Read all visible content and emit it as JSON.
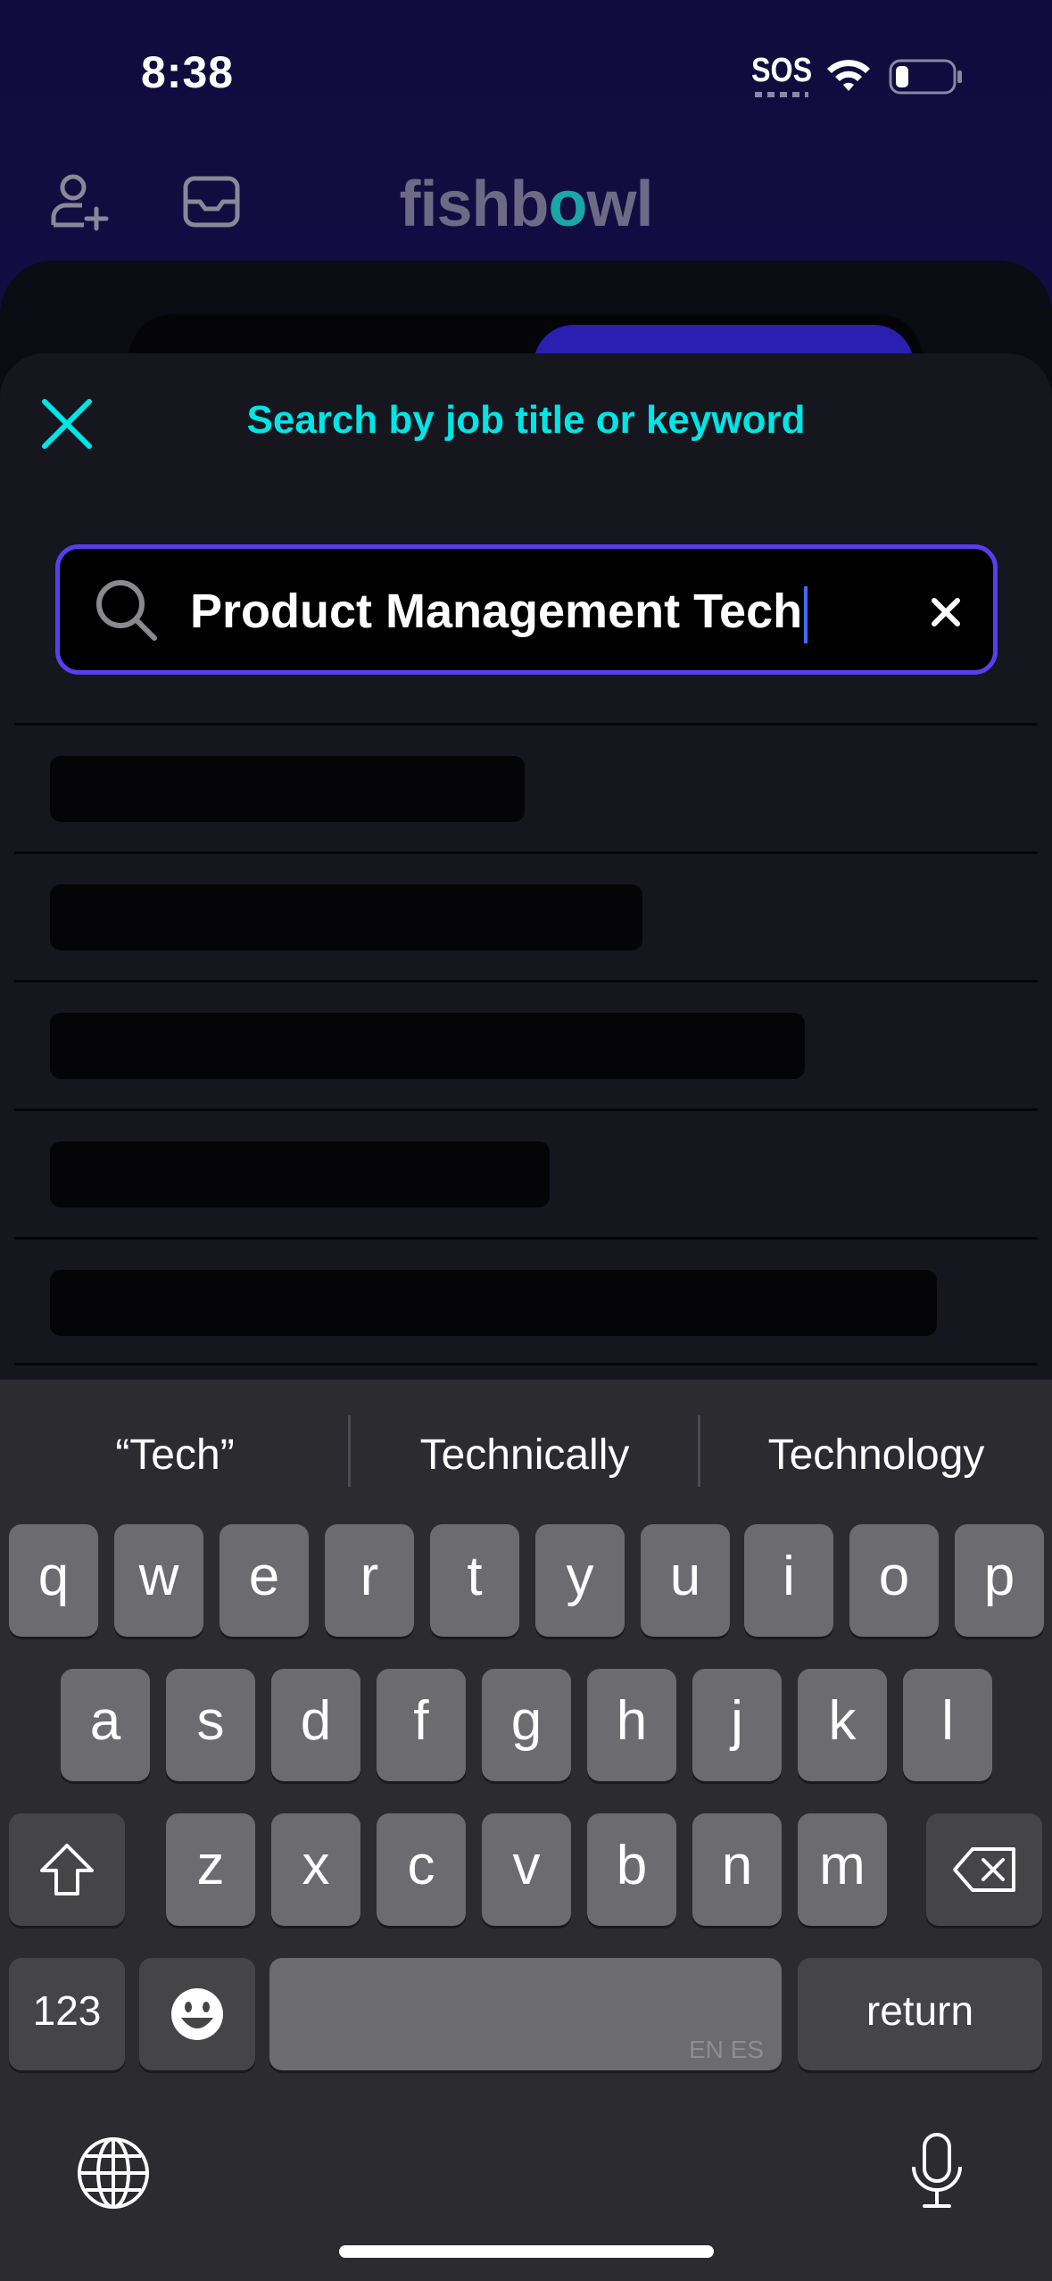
{
  "status_bar": {
    "time": "8:38",
    "sos": "SOS",
    "icons": [
      "wifi-icon",
      "battery-icon"
    ]
  },
  "header": {
    "logo_before": "fishb",
    "logo_o": "o",
    "logo_after": "wl",
    "left_icons": [
      "add-person-icon",
      "inbox-icon"
    ],
    "logo_teal_color": "#1aa6a6"
  },
  "modal": {
    "title": "Search by job title or keyword",
    "title_color": "#00e5e5",
    "search": {
      "value": "Product Management Tech"
    },
    "result_skeleton_count": 5
  },
  "keyboard": {
    "suggestions": [
      "“Tech”",
      "Technically",
      "Technology"
    ],
    "row1": [
      "q",
      "w",
      "e",
      "r",
      "t",
      "y",
      "u",
      "i",
      "o",
      "p"
    ],
    "row2": [
      "a",
      "s",
      "d",
      "f",
      "g",
      "h",
      "j",
      "k",
      "l"
    ],
    "row3": [
      "z",
      "x",
      "c",
      "v",
      "b",
      "n",
      "m"
    ],
    "numbers_label": "123",
    "return_label": "return",
    "space_languages": "EN ES"
  },
  "colors": {
    "accent_border": "#5a3df0",
    "background": "#0d0930",
    "modal_bg": "#16161f"
  }
}
